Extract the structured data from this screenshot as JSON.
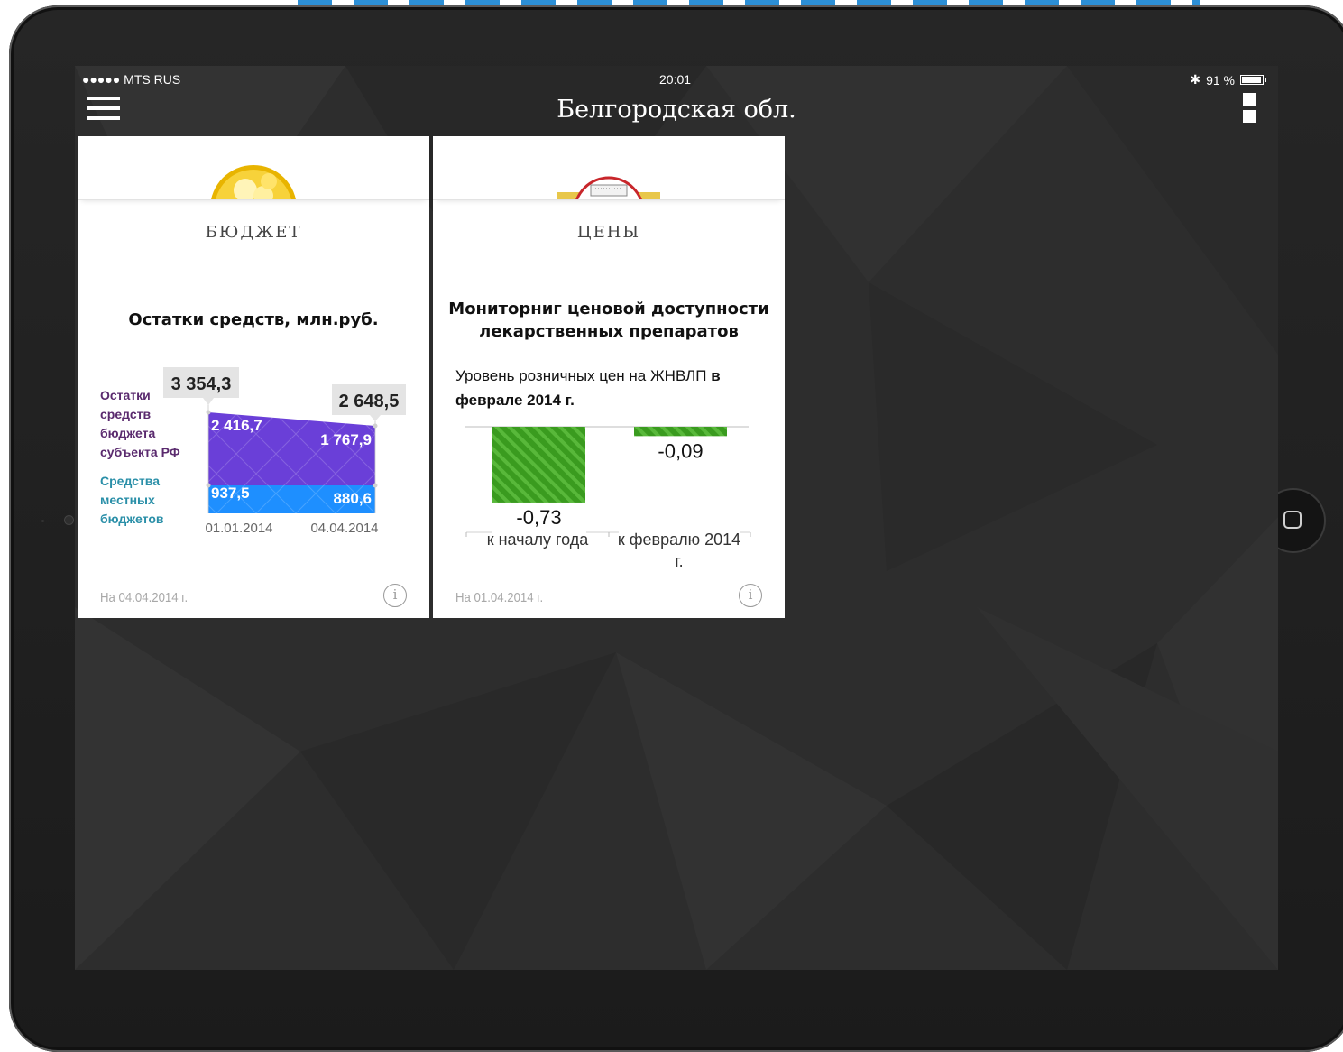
{
  "status_bar": {
    "carrier": "●●●●● MTS RUS",
    "time": "20:01",
    "battery": "91 %",
    "battery_level": 0.91
  },
  "nav": {
    "title": "Белгородская обл."
  },
  "cards": [
    {
      "heading": "БЮДЖЕТ",
      "chart_title": "Остатки средств, млн.руб.",
      "legend_budget": [
        "Остатки",
        "средств",
        "бюджета",
        "субъекта РФ"
      ],
      "legend_local": [
        "Средства",
        "местных",
        "бюджетов"
      ],
      "footer": "На 04.04.2014 г."
    },
    {
      "heading": "ЦЕНЫ",
      "chart_title_lines": [
        "Мониторниг ценовой доступности",
        "лекарственных препаратов"
      ],
      "subtitle_normal": "Уровень розничных цен на ЖНВЛП",
      "subtitle_bold_1": "в",
      "subtitle_bold_2": "феврале 2014 г.",
      "footer": "На 01.04.2014 г."
    }
  ],
  "chart_data": [
    {
      "type": "area",
      "title": "Остатки средств, млн.руб.",
      "categories": [
        "01.01.2014",
        "04.04.2014"
      ],
      "totals": [
        "3 354,3",
        "2 648,5"
      ],
      "total_values": [
        3354.3,
        2648.5
      ],
      "series": [
        {
          "name": "Остатки средств бюджета субъекта РФ",
          "values": [
            2416.7,
            1767.9
          ],
          "labels": [
            "2 416,7",
            "1 767,9"
          ],
          "color": "#6a3fd8"
        },
        {
          "name": "Средства местных бюджетов",
          "values": [
            937.5,
            880.6
          ],
          "labels": [
            "937,5",
            "880,6"
          ],
          "color": "#1e8fff"
        }
      ],
      "stacked": true
    },
    {
      "type": "bar",
      "title": "Мониторниг ценовой доступности лекарственных препаратов",
      "categories": [
        "к началу года",
        "к февралю 2014 г."
      ],
      "values": [
        -0.73,
        -0.09
      ],
      "labels": [
        "-0,73",
        "-0,09"
      ],
      "ylim": [
        -0.8,
        0
      ],
      "color": "#3a9b1f"
    }
  ]
}
